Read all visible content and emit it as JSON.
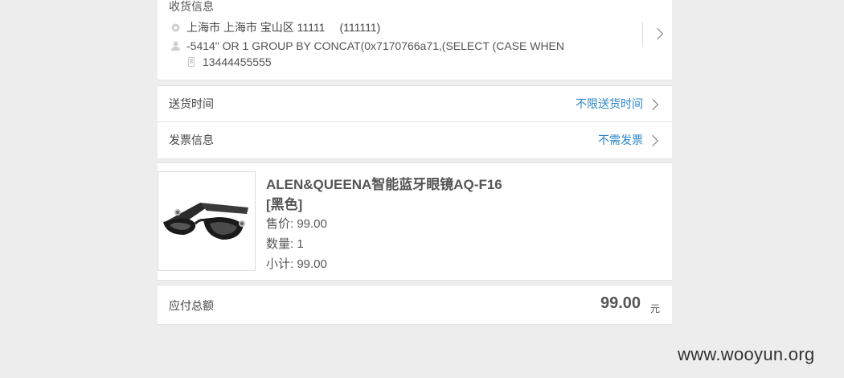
{
  "address": {
    "title": "收货信息",
    "region": "上海市 上海市 宝山区 11111",
    "postcode": "(111111)",
    "name": "-5414\" OR 1 GROUP BY CONCAT(0x7170766a71,(SELECT (CASE WHEN",
    "phone": "13444455555"
  },
  "options": {
    "delivery_label": "送货时间",
    "delivery_value": "不限送货时间",
    "invoice_label": "发票信息",
    "invoice_value": "不需发票"
  },
  "product": {
    "name": "ALEN&QUEENA智能蓝牙眼镜AQ-F16",
    "variant": "[黑色]",
    "price": "售价: 99.00",
    "quantity": "数量: 1",
    "subtotal": "小计: 99.00"
  },
  "total": {
    "label": "应付总额",
    "amount": "99.00",
    "unit": "元"
  },
  "watermark": "www.wooyun.org",
  "colors": {
    "link": "#2c86c9",
    "background": "#ededed"
  }
}
